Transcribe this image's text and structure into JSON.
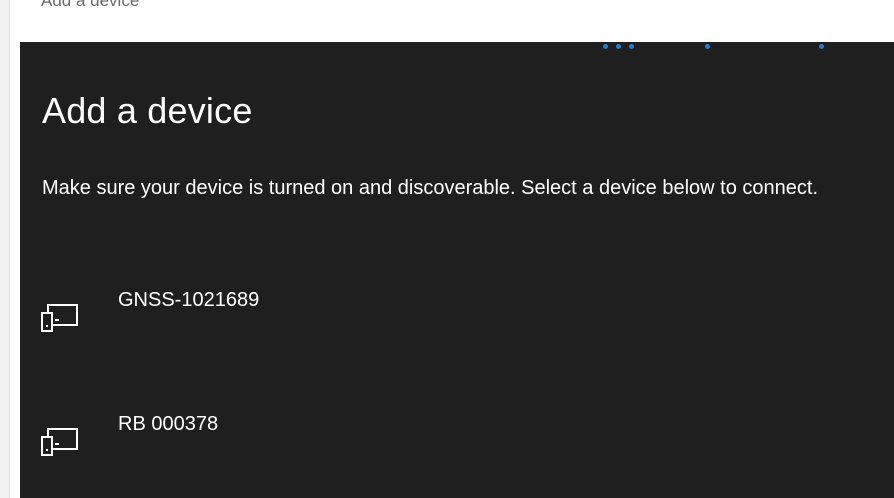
{
  "window": {
    "title": "Add a device"
  },
  "dialog": {
    "title": "Add a device",
    "instructions": "Make sure your device is turned on and discoverable. Select a device below to connect.",
    "progress": "indeterminate",
    "accent_color": "#1f7fd8",
    "background_color": "#1f1f1f"
  },
  "devices": [
    {
      "name": "GNSS-1021689",
      "icon": "device-icon"
    },
    {
      "name": "RB 000378",
      "icon": "device-icon"
    }
  ]
}
